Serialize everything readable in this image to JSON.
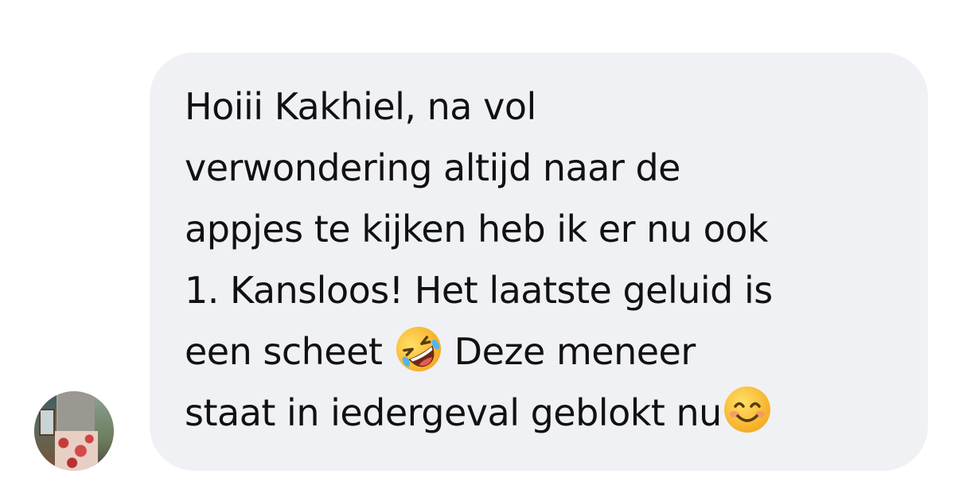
{
  "message": {
    "lines": {
      "l1": "Hoiii Kakhiel, na vol",
      "l2": "verwondering altijd naar de",
      "l3": "appjes te kijken heb ik er nu ook",
      "l4": "1. Kansloos! Het laatste geluid is",
      "l5a": "een scheet ",
      "l5b": " Deze meneer",
      "l6": "staat in iedergeval geblokt nu"
    },
    "emojis": [
      "rolling-on-floor-laughing-emoji",
      "smiling-face-with-smiling-eyes-emoji"
    ]
  },
  "colors": {
    "bubble": "#f0f1f5",
    "text": "#111111",
    "background": "#ffffff"
  }
}
